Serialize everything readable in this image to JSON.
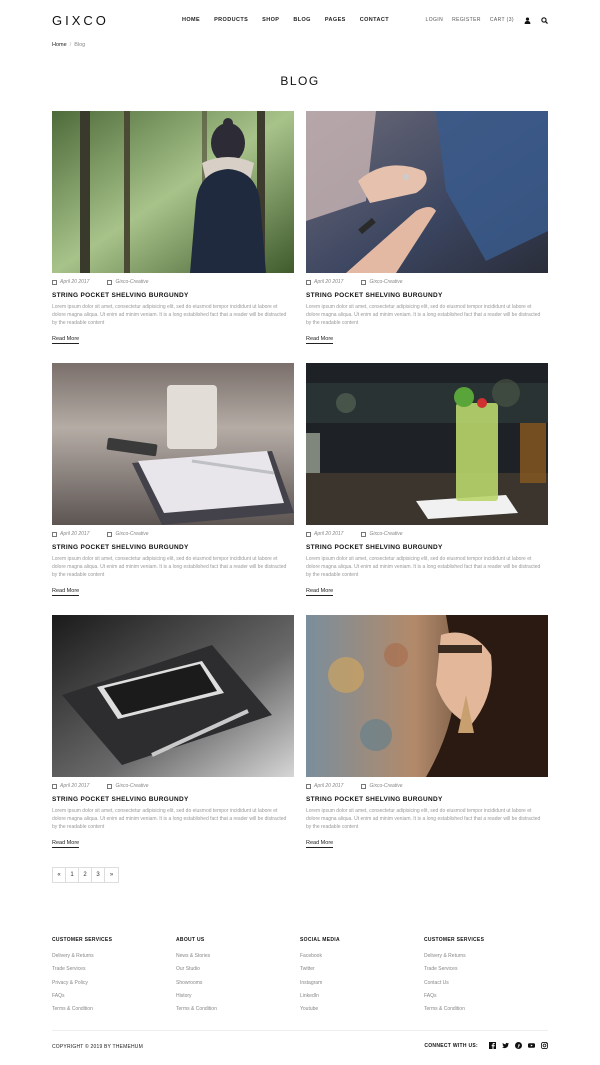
{
  "header": {
    "logo": "GIXCO",
    "nav": [
      "HOME",
      "PRODUCTS",
      "SHOP",
      "BLOG",
      "PAGES",
      "CONTACT"
    ],
    "login": "LOGIN",
    "register": "REGISTER",
    "cart": "CART (3)",
    "icons": [
      "user-icon",
      "search-icon"
    ]
  },
  "breadcrumb": {
    "home": "Home",
    "separator": "/",
    "current": "Blog"
  },
  "page_title": "BLOG",
  "posts": [
    {
      "date": "April 20 2017",
      "author": "Gixco-Creative",
      "title": "STRING POCKET SHELVING BURGUNDY",
      "excerpt": "Lorem ipsum dolor sit amet, consectetur adipisicing elit, sed do eiusmod tempor incididunt ut labore et dolore magna aliqua. Ut enim ad minim veniam. It is a long established fact that a reader will be distracted by the readable content",
      "more": "Read More",
      "image": "woman-in-forest"
    },
    {
      "date": "April 20 2017",
      "author": "Gixco-Creative",
      "title": "STRING POCKET SHELVING BURGUNDY",
      "excerpt": "Lorem ipsum dolor sit amet, consectetur adipisicing elit, sed do eiusmod tempor incididunt ut labore et dolore magna aliqua. Ut enim ad minim veniam. It is a long established fact that a reader will be distracted by the readable content",
      "more": "Read More",
      "image": "holding-hands"
    },
    {
      "date": "April 20 2017",
      "author": "Gixco-Creative",
      "title": "STRING POCKET SHELVING BURGUNDY",
      "excerpt": "Lorem ipsum dolor sit amet, consectetur adipisicing elit, sed do eiusmod tempor incididunt ut labore et dolore magna aliqua. Ut enim ad minim veniam. It is a long established fact that a reader will be distracted by the readable content",
      "more": "Read More",
      "image": "desk-notebook"
    },
    {
      "date": "April 20 2017",
      "author": "Gixco-Creative",
      "title": "STRING POCKET SHELVING BURGUNDY",
      "excerpt": "Lorem ipsum dolor sit amet, consectetur adipisicing elit, sed do eiusmod tempor incididunt ut labore et dolore magna aliqua. Ut enim ad minim veniam. It is a long established fact that a reader will be distracted by the readable content",
      "more": "Read More",
      "image": "mojito-drink"
    },
    {
      "date": "April 20 2017",
      "author": "Gixco-Creative",
      "title": "STRING POCKET SHELVING BURGUNDY",
      "excerpt": "Lorem ipsum dolor sit amet, consectetur adipisicing elit, sed do eiusmod tempor incididunt ut labore et dolore magna aliqua. Ut enim ad minim veniam. It is a long established fact that a reader will be distracted by the readable content",
      "more": "Read More",
      "image": "phone-and-pen"
    },
    {
      "date": "April 20 2017",
      "author": "Gixco-Creative",
      "title": "STRING POCKET SHELVING BURGUNDY",
      "excerpt": "Lorem ipsum dolor sit amet, consectetur adipisicing elit, sed do eiusmod tempor incididunt ut labore et dolore magna aliqua. Ut enim ad minim veniam. It is a long established fact that a reader will be distracted by the readable content",
      "more": "Read More",
      "image": "woman-with-earring"
    }
  ],
  "pagination": {
    "prev": "«",
    "pages": [
      "1",
      "2",
      "3"
    ],
    "next": "»"
  },
  "footer": {
    "columns": [
      {
        "heading": "CUSTOMER SERVICES",
        "links": [
          "Delivery & Returns",
          "Trade Services",
          "Privacy & Policy",
          "FAQs",
          "Terms & Condition"
        ]
      },
      {
        "heading": "ABOUT US",
        "links": [
          "News & Stories",
          "Our Studio",
          "Showrooms",
          "History",
          "Terms & Condition"
        ]
      },
      {
        "heading": "SOCIAL MEDIA",
        "links": [
          "Facebook",
          "Twitter",
          "Instagram",
          "LinkedIn",
          "Youtube"
        ]
      },
      {
        "heading": "CUSTOMER SERVICES",
        "links": [
          "Delivery & Returns",
          "Trade Services",
          "Contact Us",
          "FAQs",
          "Terms & Condition"
        ]
      }
    ],
    "copyright": "COPYRIGHT © 2019 BY THEMEHUM",
    "connect_label": "CONNECT WITH US:",
    "social_icons": [
      "facebook-icon",
      "twitter-icon",
      "pinterest-icon",
      "youtube-icon",
      "instagram-icon"
    ]
  }
}
